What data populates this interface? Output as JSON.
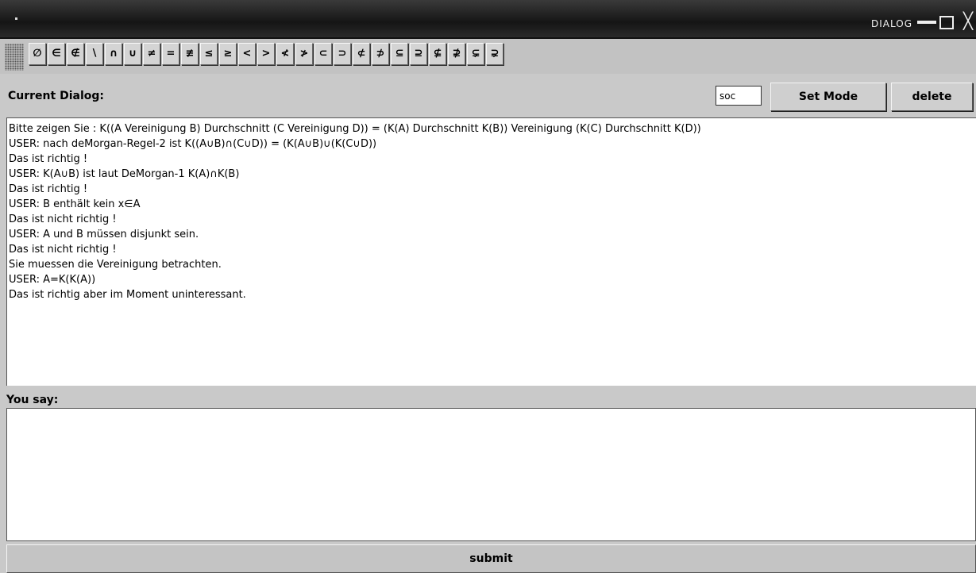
{
  "window": {
    "title": "DIALOG"
  },
  "toolbar": {
    "symbols": [
      "∅",
      "∈",
      "∉",
      "∖",
      "∩",
      "∪",
      "≠",
      "=",
      "≢",
      "≤",
      "≥",
      "<",
      ">",
      "≮",
      "≯",
      "⊂",
      "⊃",
      "⊄",
      "⊅",
      "⊆",
      "⊇",
      "⊈",
      "⊉",
      "⊊",
      "⊋"
    ]
  },
  "header": {
    "current_dialog_label": "Current Dialog:",
    "mode_value": "soc",
    "set_mode_label": "Set Mode",
    "delete_label": "delete"
  },
  "dialog": {
    "lines": [
      "Bitte zeigen Sie : K((A Vereinigung  B) Durchschnitt (C Vereinigung D)) = (K(A) Durchschnitt  K(B)) Vereinigung  (K(C) Durchschnitt K(D))",
      "USER: nach deMorgan-Regel-2 ist K((A∪B)∩(C∪D)) = (K(A∪B)∪(K(C∪D))",
      "Das ist richtig !",
      "USER: K(A∪B) ist laut DeMorgan-1 K(A)∩K(B)",
      "Das ist richtig !",
      "USER: B enthält kein x∈A",
      "Das ist nicht richtig !",
      "USER: A und B müssen disjunkt sein.",
      "Das ist nicht richtig !",
      "Sie muessen die Vereinigung betrachten.",
      "USER: A=K(K(A))",
      "Das ist richtig aber im Moment uninteressant."
    ]
  },
  "input": {
    "you_say_label": "You say:",
    "value": "",
    "submit_label": "submit"
  }
}
